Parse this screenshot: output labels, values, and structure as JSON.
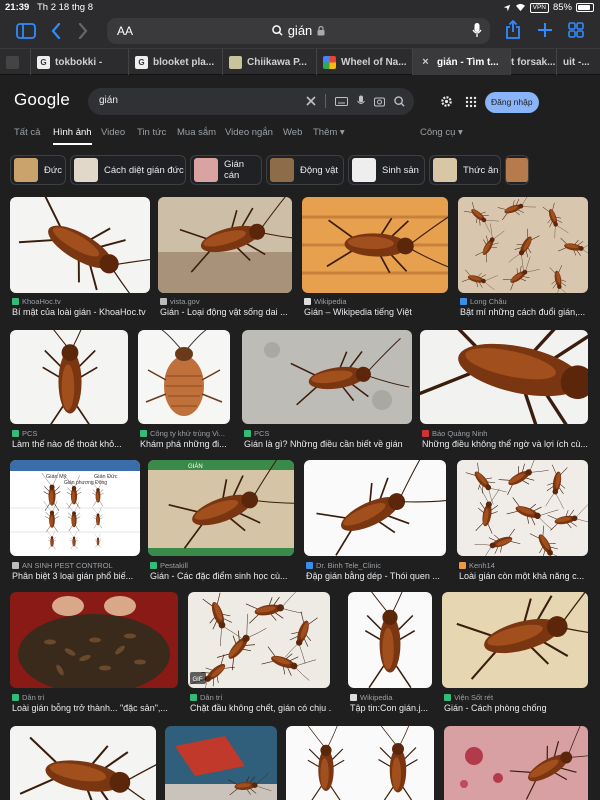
{
  "status": {
    "time": "21:39",
    "date": "Th 2 18 thg 8",
    "vpn": "VPN",
    "battery": "85%"
  },
  "browser": {
    "text_size_label": "AA",
    "address_text": "gián"
  },
  "tabs": [
    {
      "label": "",
      "favicon": ""
    },
    {
      "label": "tokbokki -",
      "favicon": "G"
    },
    {
      "label": "blooket pla...",
      "favicon": "G"
    },
    {
      "label": "Chiikawa P...",
      "favicon": ""
    },
    {
      "label": "Wheel of Na...",
      "favicon": ""
    },
    {
      "label": "gián - Tìm t...",
      "favicon": "×"
    },
    {
      "label": "t forsak...",
      "favicon": ""
    },
    {
      "label": "uit -...",
      "favicon": ""
    }
  ],
  "google": {
    "logo": "Google",
    "query": "gián",
    "login": "Đăng nhập",
    "nav": [
      "Tất cả",
      "Hình ảnh",
      "Video",
      "Tin tức",
      "Mua sắm",
      "Video ngắn",
      "Web",
      "Thêm ▾"
    ],
    "tools": "Công cụ ▾"
  },
  "chips": [
    "Đức",
    "Cách diệt gián đức",
    "Gián cán",
    "Động vật",
    "Sinh sản",
    "Thức ăn"
  ],
  "results": [
    {
      "source": "KhoaHoc.tv",
      "caption": "Bí mật của loài gián - KhoaHoc.tv"
    },
    {
      "source": "vista.gov",
      "caption": "Gián - Loại động vật sống dai ..."
    },
    {
      "source": "Wikipedia",
      "caption": "Gián – Wikipedia tiếng Việt"
    },
    {
      "source": "Long Châu",
      "caption": "Bật mí những cách đuổi gián,..."
    },
    {
      "source": "PCS",
      "caption": "Làm thế nào để thoát khỏ..."
    },
    {
      "source": "Công ty khử trùng Vi...",
      "caption": "Khám phá những đi..."
    },
    {
      "source": "PCS",
      "caption": "Gián là gì? Những điều cần biết về gián"
    },
    {
      "source": "Báo Quảng Ninh",
      "caption": "Những điều không thể ngờ và lợi ích cù..."
    },
    {
      "source": "AN SINH PEST CONTROL",
      "caption": "Phân biệt 3 loại gián phổ biế..."
    },
    {
      "source": "Pestakill",
      "caption": "Gián - Các đặc điểm sinh học cù..."
    },
    {
      "source": "Dr. Binh Tele_Clinic",
      "caption": "Đập gián bằng dép - Thói quen ..."
    },
    {
      "source": "Kenh14",
      "caption": "Loài gián còn một khả năng c..."
    },
    {
      "source": "Dân trí",
      "caption": "Loài gián bỗng trở thành... \"đặc sản\",..."
    },
    {
      "source": "Dân trí",
      "caption": "Chặt đầu không chết, gián có chịu ..."
    },
    {
      "source": "Wikipedia",
      "caption": "Tập tin:Con gián.j..."
    },
    {
      "source": "Viện Sốt rét",
      "caption": "Gián - Cách phòng chống"
    }
  ],
  "image_text": {
    "species_chart": [
      "Gián Mỹ",
      "Gián Đức",
      "Gián phương Đông"
    ],
    "pestakill_title": "GIÁN",
    "gif_badge": "GIF"
  },
  "colors": {
    "accent": "#2f8cff",
    "login_bg": "#8ab4f8",
    "page_bg": "#1f1f1f"
  }
}
